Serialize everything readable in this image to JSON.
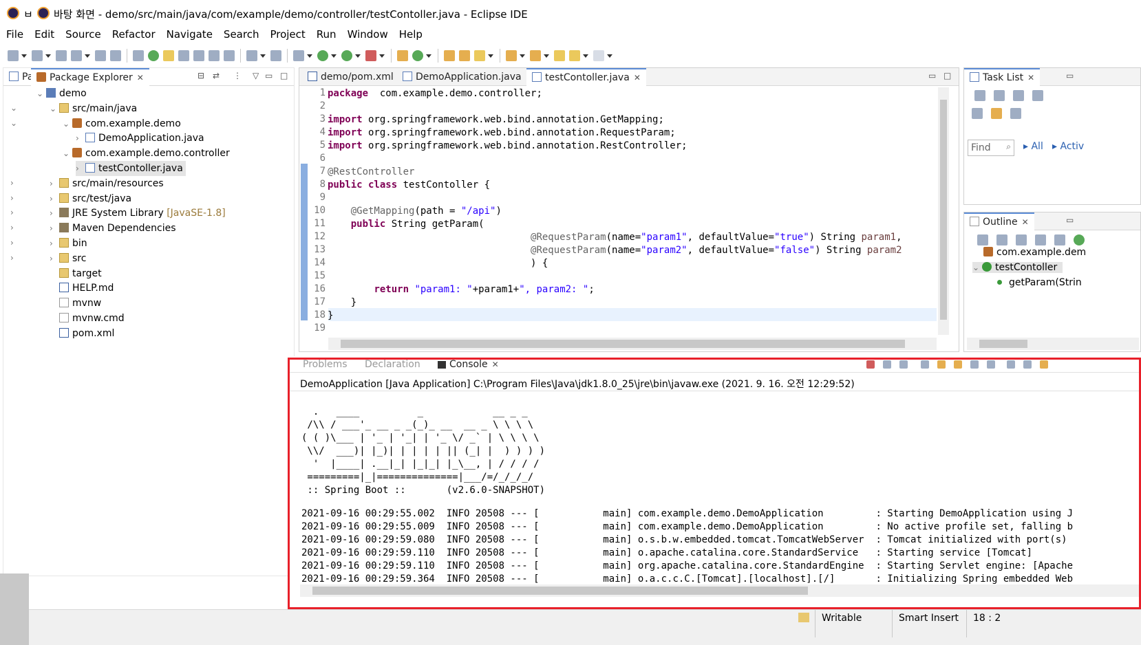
{
  "window": {
    "title_prefix": "ㅂ",
    "title": "바탕 화면 - demo/src/main/java/com/example/demo/controller/testContoller.java - Eclipse IDE"
  },
  "menu": [
    "File",
    "Edit",
    "Source",
    "Refactor",
    "Navigate",
    "Search",
    "Project",
    "Run",
    "Window",
    "Help"
  ],
  "left_panel": {
    "tab_short": "Pa",
    "tab_label": "Package Explorer",
    "tree": [
      {
        "label": "demo",
        "icon": "project-icon",
        "indent": 0,
        "twisty": "expanded"
      },
      {
        "label": "src/main/java",
        "icon": "source-folder-icon",
        "indent": 1,
        "twisty": "expanded"
      },
      {
        "label": "com.example.demo",
        "icon": "package-icon",
        "indent": 2,
        "twisty": "expanded"
      },
      {
        "label": "DemoApplication.java",
        "icon": "java-file-icon",
        "indent": 3,
        "twisty": "collapsed"
      },
      {
        "label": "com.example.demo.controller",
        "icon": "package-icon",
        "indent": 2,
        "twisty": "expanded"
      },
      {
        "label": "testContoller.java",
        "icon": "java-file-icon",
        "indent": 3,
        "twisty": "collapsed",
        "selected": true
      },
      {
        "label": "src/main/resources",
        "icon": "source-folder-icon",
        "indent": 1,
        "twisty": "collapsed"
      },
      {
        "label": "src/test/java",
        "icon": "source-folder-icon",
        "indent": 1,
        "twisty": "collapsed"
      },
      {
        "label": "JRE System Library",
        "extra": "[JavaSE-1.8]",
        "icon": "library-icon",
        "indent": 1,
        "twisty": "collapsed"
      },
      {
        "label": "Maven Dependencies",
        "icon": "library-icon",
        "indent": 1,
        "twisty": "collapsed"
      },
      {
        "label": "bin",
        "icon": "folder-icon",
        "indent": 1,
        "twisty": "collapsed"
      },
      {
        "label": "src",
        "icon": "folder-icon",
        "indent": 1,
        "twisty": "collapsed"
      },
      {
        "label": "target",
        "icon": "folder-icon",
        "indent": 1,
        "twisty": "none"
      },
      {
        "label": "HELP.md",
        "icon": "markdown-file-icon",
        "indent": 1,
        "twisty": "none"
      },
      {
        "label": "mvnw",
        "icon": "file-icon",
        "indent": 1,
        "twisty": "none"
      },
      {
        "label": "mvnw.cmd",
        "icon": "file-icon",
        "indent": 1,
        "twisty": "none"
      },
      {
        "label": "pom.xml",
        "icon": "maven-file-icon",
        "indent": 1,
        "twisty": "none"
      }
    ]
  },
  "editor": {
    "tabs": [
      {
        "label": "demo/pom.xml",
        "active": false
      },
      {
        "label": "DemoApplication.java",
        "active": false
      },
      {
        "label": "testContoller.java",
        "active": true
      }
    ],
    "lines": [
      {
        "n": "1",
        "tokens": [
          [
            "kw",
            "package"
          ],
          [
            "",
            "  com.example.demo.controller;"
          ]
        ]
      },
      {
        "n": "2",
        "tokens": []
      },
      {
        "n": "3",
        "tokens": [
          [
            "kw",
            "import"
          ],
          [
            "",
            " org.springframework.web.bind.annotation.GetMapping;"
          ]
        ]
      },
      {
        "n": "4",
        "tokens": [
          [
            "kw",
            "import"
          ],
          [
            "",
            " org.springframework.web.bind.annotation.RequestParam;"
          ]
        ]
      },
      {
        "n": "5",
        "tokens": [
          [
            "kw",
            "import"
          ],
          [
            "",
            " org.springframework.web.bind.annotation.RestController;"
          ]
        ]
      },
      {
        "n": "6",
        "tokens": []
      },
      {
        "n": "7",
        "tokens": [
          [
            "ann",
            "@RestController"
          ]
        ]
      },
      {
        "n": "8",
        "tokens": [
          [
            "kw",
            "public class"
          ],
          [
            "",
            " testContoller {"
          ]
        ]
      },
      {
        "n": "9",
        "tokens": []
      },
      {
        "n": "10",
        "tokens": [
          [
            "",
            "    "
          ],
          [
            "ann",
            "@GetMapping"
          ],
          [
            "",
            "(path = "
          ],
          [
            "str",
            "\"/api\""
          ],
          [
            "",
            ")"
          ]
        ]
      },
      {
        "n": "11",
        "tokens": [
          [
            "",
            "    "
          ],
          [
            "kw",
            "public"
          ],
          [
            "",
            " String getParam("
          ]
        ]
      },
      {
        "n": "12",
        "tokens": [
          [
            "",
            "                                   "
          ],
          [
            "ann",
            "@RequestParam"
          ],
          [
            "",
            "(name="
          ],
          [
            "str",
            "\"param1\""
          ],
          [
            "",
            ", defaultValue="
          ],
          [
            "str",
            "\"true\""
          ],
          [
            "",
            ") String "
          ],
          [
            "var",
            "param1"
          ],
          [
            "",
            ","
          ]
        ]
      },
      {
        "n": "13",
        "tokens": [
          [
            "",
            "                                   "
          ],
          [
            "ann",
            "@RequestParam"
          ],
          [
            "",
            "(name="
          ],
          [
            "str",
            "\"param2\""
          ],
          [
            "",
            ", defaultValue="
          ],
          [
            "str",
            "\"false\""
          ],
          [
            "",
            ") String "
          ],
          [
            "var",
            "param2"
          ]
        ]
      },
      {
        "n": "14",
        "tokens": [
          [
            "",
            "                                   ) {"
          ]
        ]
      },
      {
        "n": "15",
        "tokens": []
      },
      {
        "n": "16",
        "tokens": [
          [
            "",
            "        "
          ],
          [
            "kw",
            "return"
          ],
          [
            "",
            " "
          ],
          [
            "str",
            "\"param1: \""
          ],
          [
            "",
            "+param1+"
          ],
          [
            "str",
            "\", param2: \""
          ],
          [
            "",
            ";"
          ]
        ]
      },
      {
        "n": "17",
        "tokens": [
          [
            "",
            "    }"
          ]
        ]
      },
      {
        "n": "18",
        "tokens": [
          [
            "",
            "}"
          ]
        ]
      },
      {
        "n": "19",
        "tokens": []
      }
    ]
  },
  "task_list": {
    "tab_label": "Task List",
    "find_placeholder": "Find",
    "all_label": "All",
    "activate_label": "Activ"
  },
  "outline": {
    "tab_label": "Outline",
    "items": [
      "com.example.dem",
      "testContoller",
      "getParam(Strin"
    ]
  },
  "console": {
    "tabs": [
      "Problems",
      "Declaration",
      "Console"
    ],
    "header": "DemoApplication [Java Application] C:\\Program Files\\Java\\jdk1.8.0_25\\jre\\bin\\javaw.exe (2021. 9. 16. 오전 12:29:52)",
    "banner": [
      "  .   ____          _            __ _ _",
      " /\\\\ / ___'_ __ _ _(_)_ __  __ _ \\ \\ \\ \\",
      "( ( )\\___ | '_ | '_| | '_ \\/ _` | \\ \\ \\ \\",
      " \\\\/  ___)| |_)| | | | | || (_| |  ) ) ) )",
      "  '  |____| .__|_| |_|_| |_\\__, | / / / /",
      " =========|_|==============|___/=/_/_/_/",
      " :: Spring Boot ::       (v2.6.0-SNAPSHOT)"
    ],
    "log": [
      "2021-09-16 00:29:55.002  INFO 20508 --- [           main] com.example.demo.DemoApplication         : Starting DemoApplication using J",
      "2021-09-16 00:29:55.009  INFO 20508 --- [           main] com.example.demo.DemoApplication         : No active profile set, falling b",
      "2021-09-16 00:29:59.080  INFO 20508 --- [           main] o.s.b.w.embedded.tomcat.TomcatWebServer  : Tomcat initialized with port(s)",
      "2021-09-16 00:29:59.110  INFO 20508 --- [           main] o.apache.catalina.core.StandardService   : Starting service [Tomcat]",
      "2021-09-16 00:29:59.110  INFO 20508 --- [           main] org.apache.catalina.core.StandardEngine  : Starting Servlet engine: [Apache",
      "2021-09-16 00:29:59.364  INFO 20508 --- [           main] o.a.c.c.C.[Tomcat].[localhost].[/]       : Initializing Spring embedded Web"
    ]
  },
  "status_bar": {
    "writable": "Writable",
    "insert_mode": "Smart Insert",
    "position": "18 : 2"
  },
  "colors": {
    "highlight_box": "#e8202a",
    "keyword": "#7f0055",
    "string": "#2a00ff",
    "annotation": "#646464"
  }
}
